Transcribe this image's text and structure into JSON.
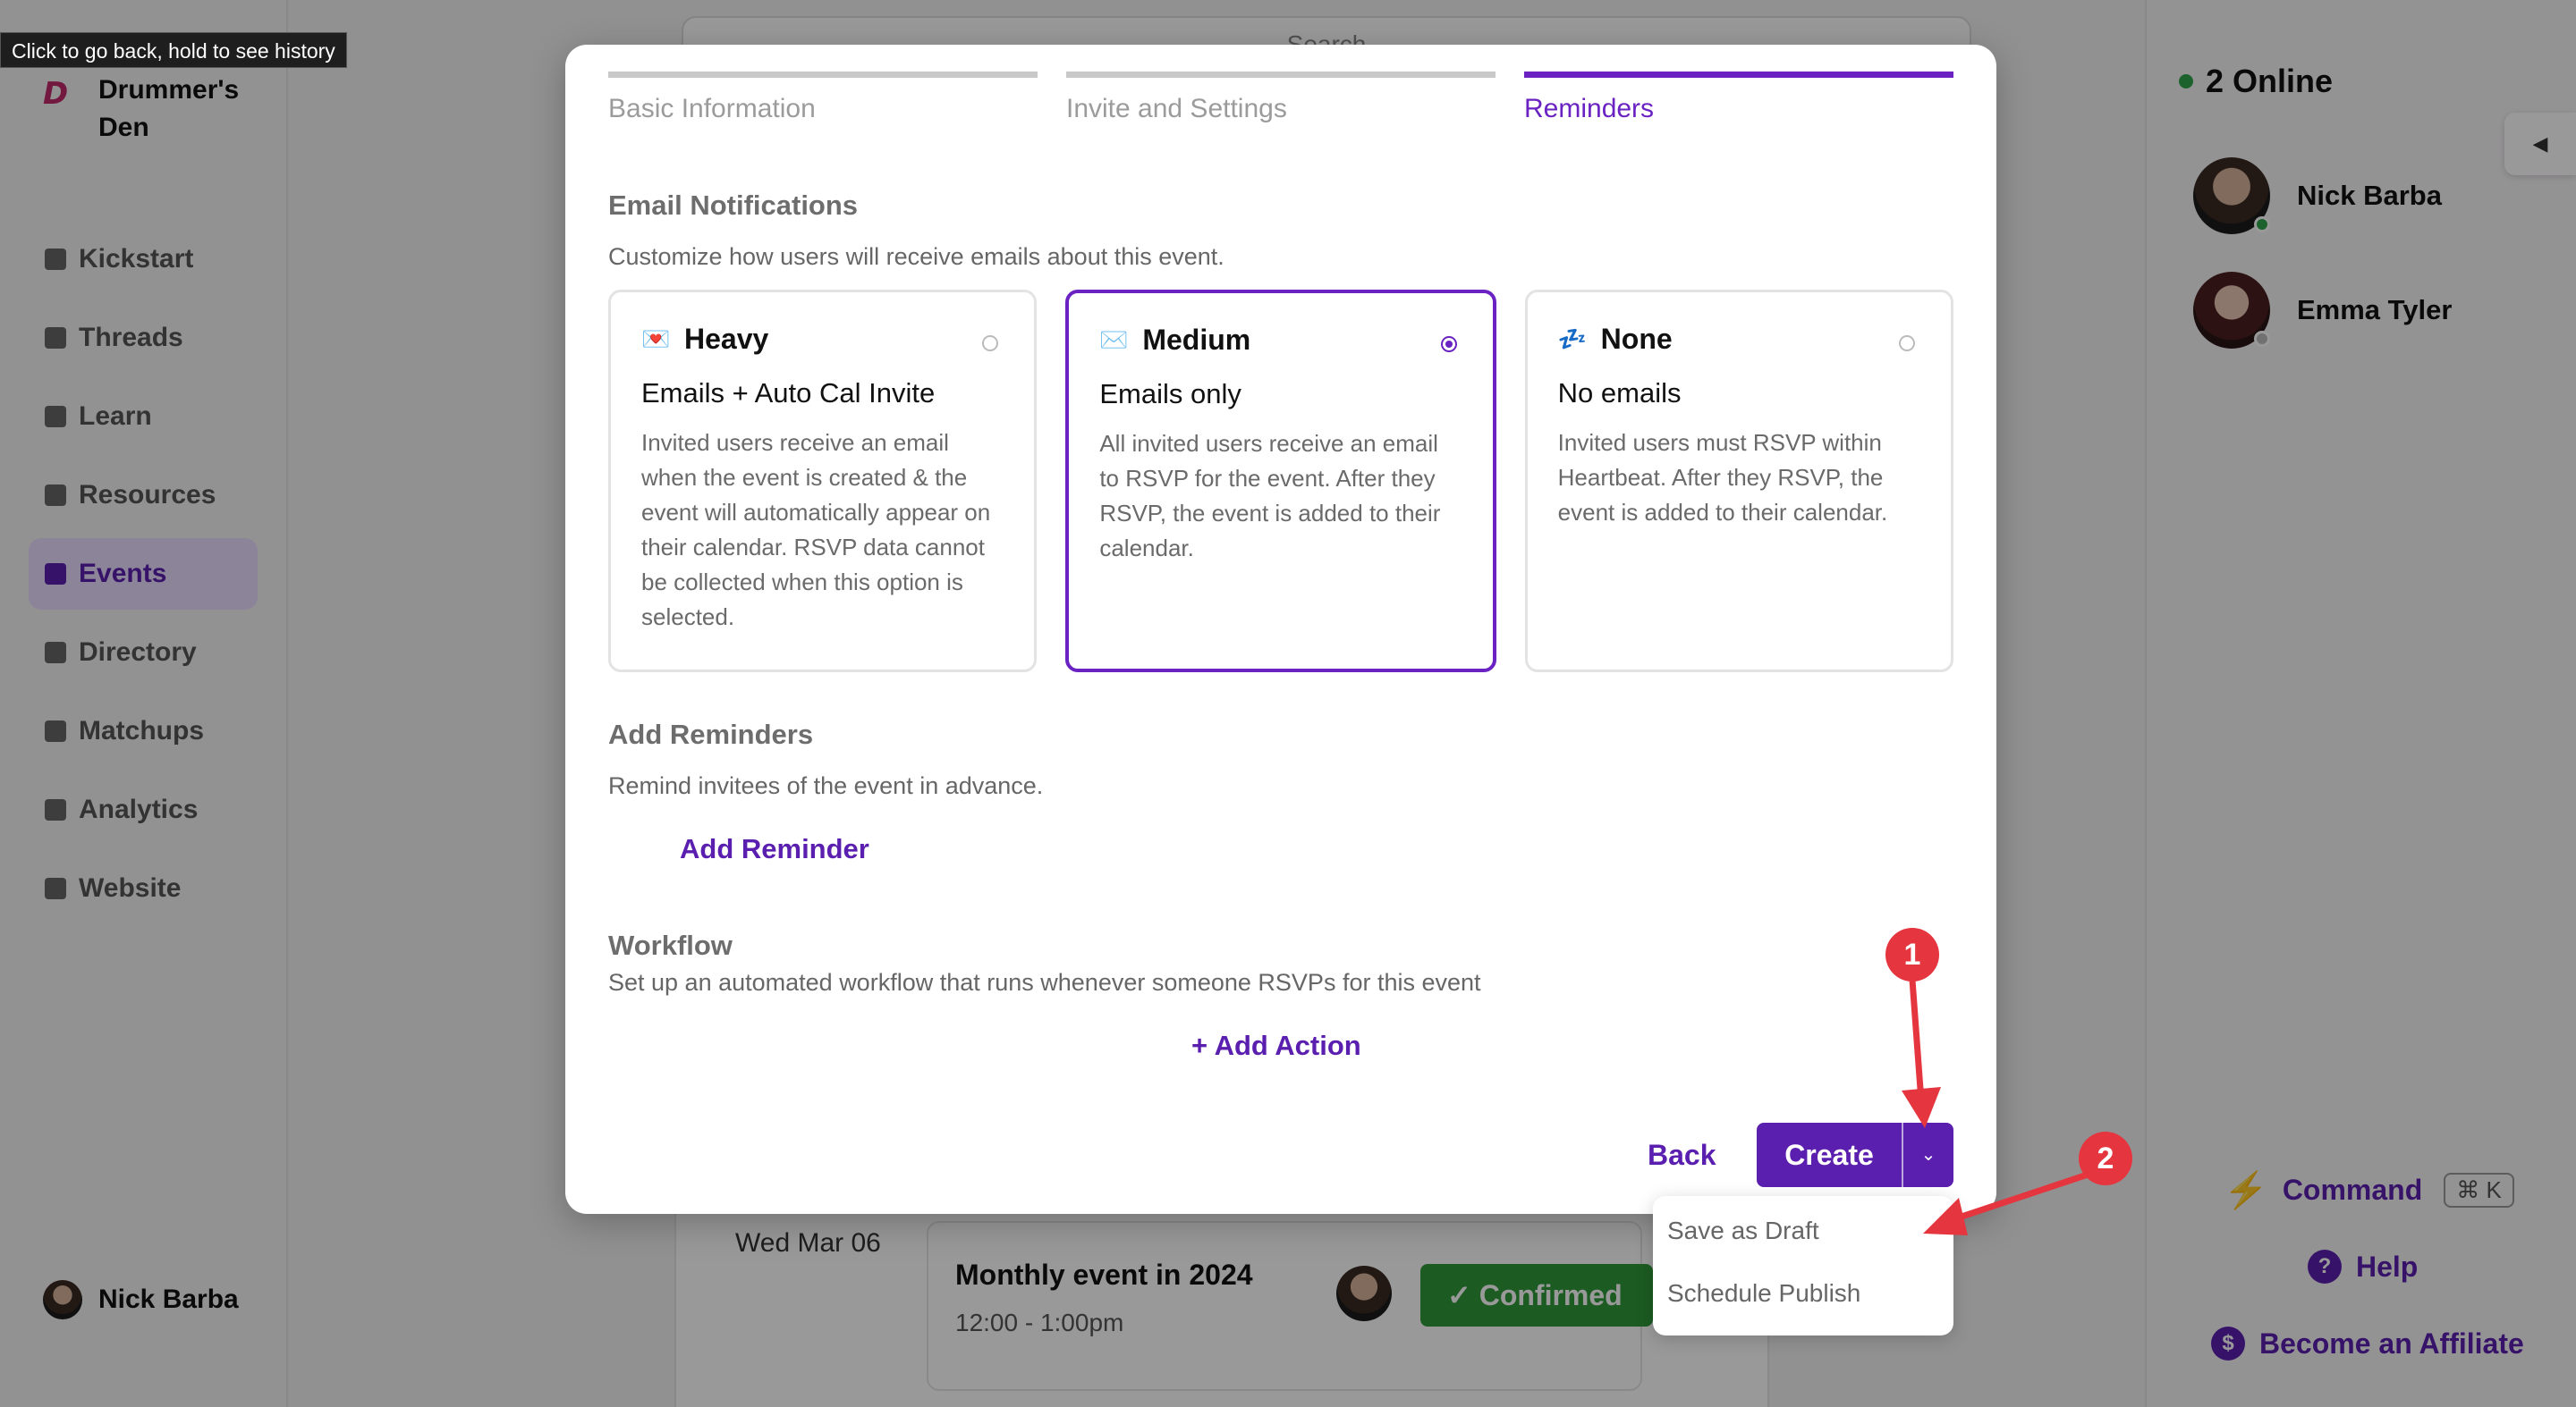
{
  "tooltip": "Click to go back, hold to see history",
  "sidebar": {
    "brand": "Drummer's Den",
    "items": [
      {
        "label": "Kickstart"
      },
      {
        "label": "Threads"
      },
      {
        "label": "Learn"
      },
      {
        "label": "Resources"
      },
      {
        "label": "Events",
        "active": true
      },
      {
        "label": "Directory"
      },
      {
        "label": "Matchups"
      },
      {
        "label": "Analytics"
      },
      {
        "label": "Website"
      }
    ],
    "user": "Nick Barba"
  },
  "main": {
    "search_placeholder": "Search",
    "event": {
      "date": "Wed Mar 06",
      "title": "Monthly event in 2024",
      "time": "12:00 - 1:00pm",
      "status": "Confirmed"
    }
  },
  "right_panel": {
    "online": "2 Online",
    "members": [
      {
        "name": "Nick Barba",
        "status_color": "#2fa34a"
      },
      {
        "name": "Emma Tyler",
        "status_color": "#bdbdbd"
      }
    ],
    "command": "Command",
    "shortcut": "⌘ K",
    "help": "Help",
    "affiliate": "Become an Affiliate"
  },
  "modal": {
    "steps": [
      "Basic Information",
      "Invite and Settings",
      "Reminders"
    ],
    "active_step": 2,
    "email": {
      "title": "Email Notifications",
      "desc": "Customize how users will receive emails about this event.",
      "options": [
        {
          "emoji": "💌",
          "name": "Heavy",
          "subtitle": "Emails + Auto Cal Invite",
          "body": "Invited users receive an email when the event is created & the event will automatically appear on their calendar. RSVP data cannot be collected when this option is selected.",
          "selected": false
        },
        {
          "emoji": "✉️",
          "name": "Medium",
          "subtitle": "Emails only",
          "body": "All invited users receive an email to RSVP for the event. After they RSVP, the event is added to their calendar.",
          "selected": true
        },
        {
          "emoji": "💤",
          "name": "None",
          "subtitle": "No emails",
          "body": "Invited users must RSVP within Heartbeat. After they RSVP, the event is added to their calendar.",
          "selected": false
        }
      ]
    },
    "reminders": {
      "title": "Add Reminders",
      "desc": "Remind invitees of the event in advance.",
      "action": "Add Reminder"
    },
    "workflow": {
      "title": "Workflow",
      "desc": "Set up an automated workflow that runs whenever someone RSVPs for this event",
      "action": "+ Add Action"
    },
    "back": "Back",
    "create": "Create",
    "dropdown": [
      "Save as Draft",
      "Schedule Publish"
    ]
  },
  "annotations": [
    "1",
    "2"
  ],
  "colors": {
    "accent": "#5b1fb0",
    "annotation": "#e5353e",
    "confirmed": "#2f9a3a"
  }
}
